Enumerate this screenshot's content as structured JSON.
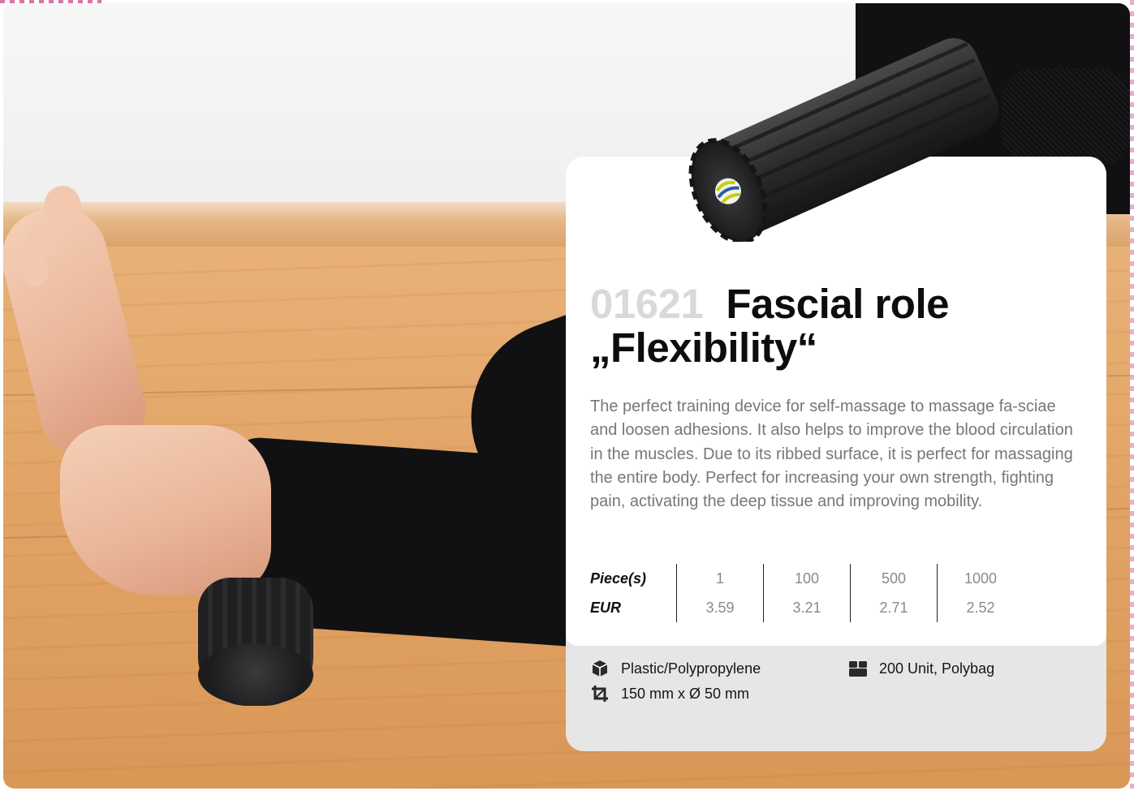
{
  "product": {
    "code": "01621",
    "title_line1": "Fascial role",
    "title_line2": "„Flexibility“",
    "description": "The perfect training device for self-massage to massage fa-sciae and loosen adhesions. It also helps to improve the blood circulation in the muscles. Due to its ribbed surface, it is perfect for massaging the entire body. Perfect for increasing your own strength, fighting pain, activating the deep tissue and improving mobility."
  },
  "pricing": {
    "quantity_label": "Piece(s)",
    "price_label": "EUR",
    "quantities": [
      "1",
      "100",
      "500",
      "1000"
    ],
    "prices": [
      "3.59",
      "3.21",
      "2.71",
      "2.52"
    ]
  },
  "specs": {
    "material": "Plastic/Polypropylene",
    "dimensions": "150 mm x Ø 50 mm",
    "packaging": "200 Unit, Polybag",
    "material_icon": "box-icon",
    "dimensions_icon": "crop-icon",
    "packaging_icon": "package-icon"
  },
  "colors": {
    "title": "#0d0d0d",
    "code": "#d9d9d9",
    "description": "#777777",
    "card_top": "#ffffff",
    "card_bottom": "#e6e6e6"
  }
}
